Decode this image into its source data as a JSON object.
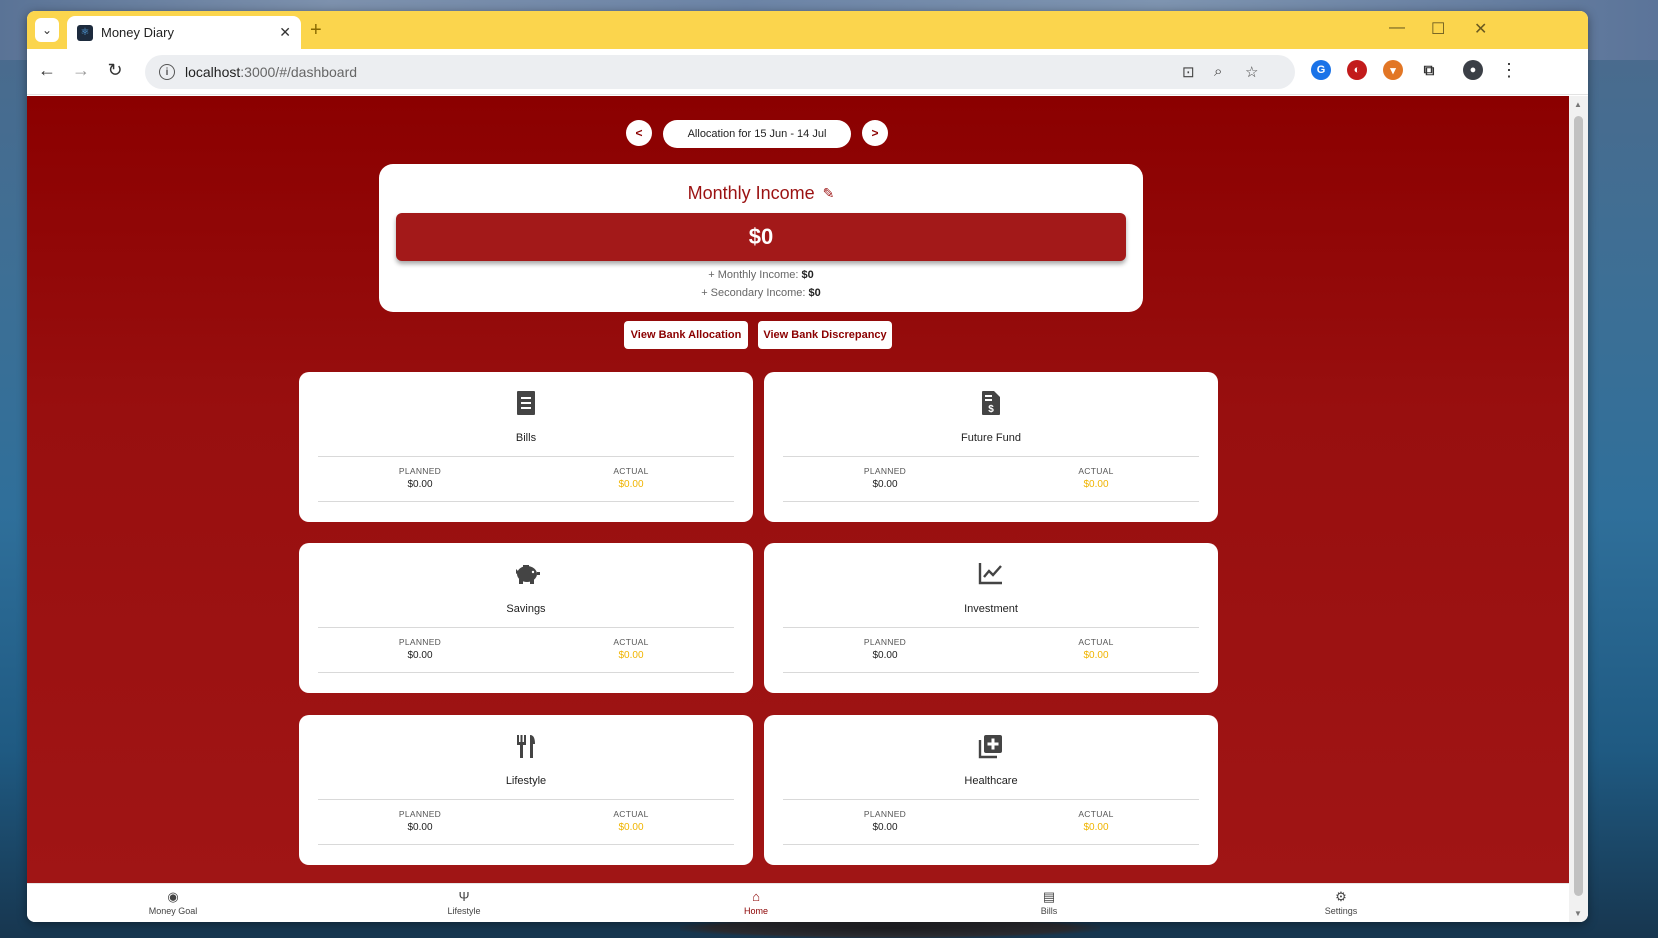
{
  "browser": {
    "tab_title": "Money Diary",
    "url_host": "localhost",
    "url_rest": ":3000/#/dashboard"
  },
  "period": {
    "prev_label": "<",
    "next_label": ">",
    "label": "Allocation for 15 Jun - 14 Jul"
  },
  "income": {
    "title": "Monthly Income",
    "total": "$0",
    "monthly_label": "+ Monthly Income:",
    "monthly_value": "$0",
    "secondary_label": "+ Secondary Income:",
    "secondary_value": "$0"
  },
  "bank_buttons": {
    "allocation": "View Bank Allocation",
    "discrepancy": "View Bank Discrepancy"
  },
  "categories": [
    {
      "name": "Bills",
      "icon": "receipt-icon",
      "planned_label": "PLANNED",
      "planned": "$0.00",
      "actual_label": "ACTUAL",
      "actual": "$0.00"
    },
    {
      "name": "Future Fund",
      "icon": "dollar-document-icon",
      "planned_label": "PLANNED",
      "planned": "$0.00",
      "actual_label": "ACTUAL",
      "actual": "$0.00"
    },
    {
      "name": "Savings",
      "icon": "piggy-bank-icon",
      "planned_label": "PLANNED",
      "planned": "$0.00",
      "actual_label": "ACTUAL",
      "actual": "$0.00"
    },
    {
      "name": "Investment",
      "icon": "line-chart-icon",
      "planned_label": "PLANNED",
      "planned": "$0.00",
      "actual_label": "ACTUAL",
      "actual": "$0.00"
    },
    {
      "name": "Lifestyle",
      "icon": "fork-knife-icon",
      "planned_label": "PLANNED",
      "planned": "$0.00",
      "actual_label": "ACTUAL",
      "actual": "$0.00"
    },
    {
      "name": "Healthcare",
      "icon": "medical-plus-icon",
      "planned_label": "PLANNED",
      "planned": "$0.00",
      "actual_label": "ACTUAL",
      "actual": "$0.00"
    }
  ],
  "bottom_nav": [
    {
      "label": "Money Goal",
      "icon": "compass-icon"
    },
    {
      "label": "Lifestyle",
      "icon": "fork-knife-icon"
    },
    {
      "label": "Home",
      "icon": "home-icon",
      "active": true
    },
    {
      "label": "Bills",
      "icon": "receipt-icon"
    },
    {
      "label": "Settings",
      "icon": "gear-icon"
    }
  ],
  "colors": {
    "primary": "#8b0000",
    "accent_actual": "#f0b400",
    "tabstrip": "#fbd54d"
  }
}
